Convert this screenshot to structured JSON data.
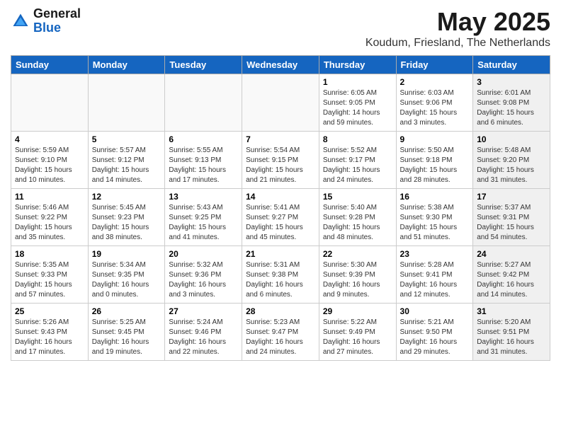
{
  "header": {
    "logo_general": "General",
    "logo_blue": "Blue",
    "month_title": "May 2025",
    "location": "Koudum, Friesland, The Netherlands"
  },
  "days_of_week": [
    "Sunday",
    "Monday",
    "Tuesday",
    "Wednesday",
    "Thursday",
    "Friday",
    "Saturday"
  ],
  "weeks": [
    [
      {
        "num": "",
        "empty": true
      },
      {
        "num": "",
        "empty": true
      },
      {
        "num": "",
        "empty": true
      },
      {
        "num": "",
        "empty": true
      },
      {
        "num": "1",
        "sunrise": "6:05 AM",
        "sunset": "9:05 PM",
        "daylight": "14 hours and 59 minutes."
      },
      {
        "num": "2",
        "sunrise": "6:03 AM",
        "sunset": "9:06 PM",
        "daylight": "15 hours and 3 minutes."
      },
      {
        "num": "3",
        "sunrise": "6:01 AM",
        "sunset": "9:08 PM",
        "daylight": "15 hours and 6 minutes.",
        "shaded": true
      }
    ],
    [
      {
        "num": "4",
        "sunrise": "5:59 AM",
        "sunset": "9:10 PM",
        "daylight": "15 hours and 10 minutes."
      },
      {
        "num": "5",
        "sunrise": "5:57 AM",
        "sunset": "9:12 PM",
        "daylight": "15 hours and 14 minutes."
      },
      {
        "num": "6",
        "sunrise": "5:55 AM",
        "sunset": "9:13 PM",
        "daylight": "15 hours and 17 minutes."
      },
      {
        "num": "7",
        "sunrise": "5:54 AM",
        "sunset": "9:15 PM",
        "daylight": "15 hours and 21 minutes."
      },
      {
        "num": "8",
        "sunrise": "5:52 AM",
        "sunset": "9:17 PM",
        "daylight": "15 hours and 24 minutes."
      },
      {
        "num": "9",
        "sunrise": "5:50 AM",
        "sunset": "9:18 PM",
        "daylight": "15 hours and 28 minutes."
      },
      {
        "num": "10",
        "sunrise": "5:48 AM",
        "sunset": "9:20 PM",
        "daylight": "15 hours and 31 minutes.",
        "shaded": true
      }
    ],
    [
      {
        "num": "11",
        "sunrise": "5:46 AM",
        "sunset": "9:22 PM",
        "daylight": "15 hours and 35 minutes."
      },
      {
        "num": "12",
        "sunrise": "5:45 AM",
        "sunset": "9:23 PM",
        "daylight": "15 hours and 38 minutes."
      },
      {
        "num": "13",
        "sunrise": "5:43 AM",
        "sunset": "9:25 PM",
        "daylight": "15 hours and 41 minutes."
      },
      {
        "num": "14",
        "sunrise": "5:41 AM",
        "sunset": "9:27 PM",
        "daylight": "15 hours and 45 minutes."
      },
      {
        "num": "15",
        "sunrise": "5:40 AM",
        "sunset": "9:28 PM",
        "daylight": "15 hours and 48 minutes."
      },
      {
        "num": "16",
        "sunrise": "5:38 AM",
        "sunset": "9:30 PM",
        "daylight": "15 hours and 51 minutes."
      },
      {
        "num": "17",
        "sunrise": "5:37 AM",
        "sunset": "9:31 PM",
        "daylight": "15 hours and 54 minutes.",
        "shaded": true
      }
    ],
    [
      {
        "num": "18",
        "sunrise": "5:35 AM",
        "sunset": "9:33 PM",
        "daylight": "15 hours and 57 minutes."
      },
      {
        "num": "19",
        "sunrise": "5:34 AM",
        "sunset": "9:35 PM",
        "daylight": "16 hours and 0 minutes."
      },
      {
        "num": "20",
        "sunrise": "5:32 AM",
        "sunset": "9:36 PM",
        "daylight": "16 hours and 3 minutes."
      },
      {
        "num": "21",
        "sunrise": "5:31 AM",
        "sunset": "9:38 PM",
        "daylight": "16 hours and 6 minutes."
      },
      {
        "num": "22",
        "sunrise": "5:30 AM",
        "sunset": "9:39 PM",
        "daylight": "16 hours and 9 minutes."
      },
      {
        "num": "23",
        "sunrise": "5:28 AM",
        "sunset": "9:41 PM",
        "daylight": "16 hours and 12 minutes."
      },
      {
        "num": "24",
        "sunrise": "5:27 AM",
        "sunset": "9:42 PM",
        "daylight": "16 hours and 14 minutes.",
        "shaded": true
      }
    ],
    [
      {
        "num": "25",
        "sunrise": "5:26 AM",
        "sunset": "9:43 PM",
        "daylight": "16 hours and 17 minutes."
      },
      {
        "num": "26",
        "sunrise": "5:25 AM",
        "sunset": "9:45 PM",
        "daylight": "16 hours and 19 minutes."
      },
      {
        "num": "27",
        "sunrise": "5:24 AM",
        "sunset": "9:46 PM",
        "daylight": "16 hours and 22 minutes."
      },
      {
        "num": "28",
        "sunrise": "5:23 AM",
        "sunset": "9:47 PM",
        "daylight": "16 hours and 24 minutes."
      },
      {
        "num": "29",
        "sunrise": "5:22 AM",
        "sunset": "9:49 PM",
        "daylight": "16 hours and 27 minutes."
      },
      {
        "num": "30",
        "sunrise": "5:21 AM",
        "sunset": "9:50 PM",
        "daylight": "16 hours and 29 minutes."
      },
      {
        "num": "31",
        "sunrise": "5:20 AM",
        "sunset": "9:51 PM",
        "daylight": "16 hours and 31 minutes.",
        "shaded": true
      }
    ]
  ]
}
